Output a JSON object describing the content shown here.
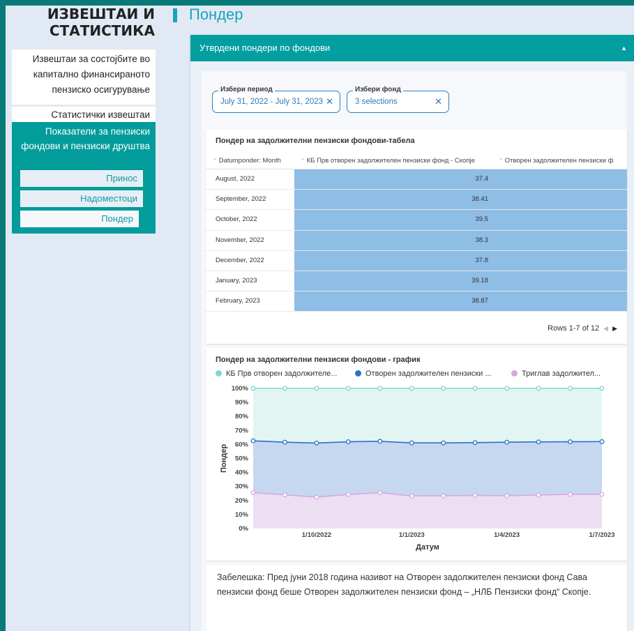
{
  "sidebar": {
    "title_line1": "ИЗВЕШТАИ И",
    "title_line2": "СТАТИСТИКА",
    "reports_link": "Извештаи за состојбите во капитално финансираното пензиско осигурување",
    "stats_link": "Статистички извештаи",
    "active_section": "Показатели за пензиски фондови и пензиски друштва",
    "sub_items": [
      "Принос",
      "Надоместоци",
      "Пондер"
    ]
  },
  "page": {
    "title": "Пондер"
  },
  "panel": {
    "header": "Утврдени пондери по фондови"
  },
  "filters": {
    "period": {
      "label": "Избери период",
      "value": "July 31, 2022 - July 31, 2023"
    },
    "fund": {
      "label": "Избери фонд",
      "value": "3 selections"
    }
  },
  "table": {
    "title": "Пондер на задолжителни пензиски фондови-табела",
    "columns": [
      "Datumponder: Month",
      "КБ Прв отворен задолжителен пензиски фонд - Скопје",
      "Отворен задолжителен пензиски ф"
    ],
    "rows": [
      {
        "month": "August, 2022",
        "value": "37.4"
      },
      {
        "month": "September, 2022",
        "value": "38.41"
      },
      {
        "month": "October, 2022",
        "value": "39.5"
      },
      {
        "month": "November, 2022",
        "value": "38.3"
      },
      {
        "month": "December, 2022",
        "value": "37.8"
      },
      {
        "month": "January, 2023",
        "value": "39.18"
      },
      {
        "month": "February, 2023",
        "value": "38.87"
      }
    ],
    "pager": "Rows 1-7 of 12"
  },
  "chart_data": {
    "type": "area",
    "title": "Пондер на задолжителни пензиски фондови - график",
    "xlabel": "Датум",
    "ylabel": "Пондер",
    "y_ticks": [
      "0%",
      "10%",
      "20%",
      "30%",
      "40%",
      "50%",
      "60%",
      "70%",
      "80%",
      "90%",
      "100%"
    ],
    "x_ticks": [
      "1/10/2022",
      "1/1/2023",
      "1/4/2023",
      "1/7/2023"
    ],
    "ylim": [
      0,
      100
    ],
    "x": [
      "2022-08",
      "2022-09",
      "2022-10",
      "2022-11",
      "2022-12",
      "2023-01",
      "2023-02",
      "2023-03",
      "2023-04",
      "2023-05",
      "2023-06",
      "2023-07"
    ],
    "series": [
      {
        "name": "КБ Прв отворен задолжителе...",
        "color": "#7fd6d3",
        "fill": "#e3f5f2",
        "values": [
          100,
          100,
          100,
          100,
          100,
          100,
          100,
          100,
          100,
          100,
          100,
          100
        ]
      },
      {
        "name": "Отворен задолжителен пензиски ...",
        "color": "#2e6fc9",
        "fill": "#c5d8ef",
        "values": [
          62.6,
          61.6,
          61.0,
          61.9,
          62.2,
          61.1,
          61.1,
          61.3,
          61.6,
          61.8,
          61.9,
          62.0
        ]
      },
      {
        "name": "Триглав задолжител...",
        "color": "#d6a8df",
        "fill": "#ecdff1",
        "values": [
          25.6,
          24.0,
          22.4,
          24.3,
          25.6,
          23.2,
          23.4,
          23.6,
          23.4,
          23.9,
          24.4,
          24.4
        ]
      }
    ],
    "legend_position": "top"
  },
  "note": {
    "text": "Забелешка: Пред јуни 2018 година називот на Отворен задолжителен пензиски фонд Сава пензиски фонд беше Отворен задолжителен пензиски фонд – „НЛБ Пензиски фонд“ Скопје."
  }
}
